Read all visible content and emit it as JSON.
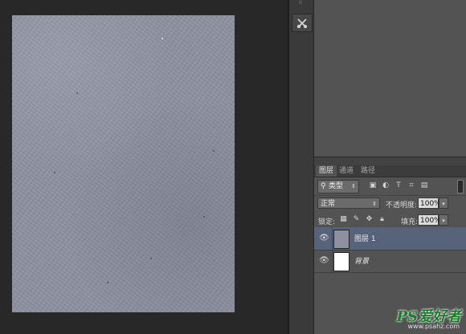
{
  "document": {
    "texture_color": "#8c90a0"
  },
  "tool_dock": {
    "grip": "ii",
    "tool_icon": "tools-icon"
  },
  "layers_panel": {
    "tabs": [
      {
        "label": "图层",
        "active": true
      },
      {
        "label": "通道",
        "active": false
      },
      {
        "label": "路径",
        "active": false
      }
    ],
    "filter": {
      "label": "类型",
      "icons": [
        "image-filter-icon",
        "adjustment-filter-icon",
        "type-filter-icon",
        "shape-filter-icon",
        "smart-object-filter-icon"
      ]
    },
    "blend_mode": "正常",
    "opacity_label": "不透明度:",
    "opacity_value": "100%",
    "lock_label": "锁定:",
    "lock_icons": [
      "lock-transparent-icon",
      "lock-paint-icon",
      "lock-position-icon",
      "lock-all-icon"
    ],
    "fill_label": "填充:",
    "fill_value": "100%",
    "layers": [
      {
        "name": "图层 1",
        "selected": true,
        "italic": false
      },
      {
        "name": "背景",
        "selected": false,
        "italic": true
      }
    ],
    "selected_color": "#56637a"
  },
  "watermark": {
    "main": "PS爱好者",
    "sub": "www.psahz.com",
    "color": "#1c7a2a"
  }
}
